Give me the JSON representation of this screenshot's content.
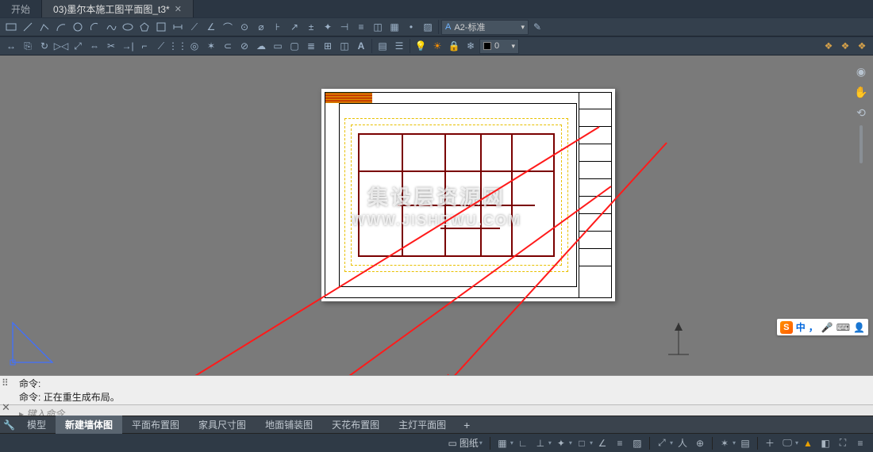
{
  "tabs": {
    "start": "开始",
    "file": "03)墨尔本施工图平面图_t3*"
  },
  "layer": {
    "combo": "A2-标准"
  },
  "color": {
    "label": "0"
  },
  "watermark": {
    "line1": "集设层资源网",
    "line2": "WWW.JISHEWU.COM"
  },
  "command": {
    "prompt1": "命令:",
    "prompt2": "命令:",
    "status": "正在重生成布局。",
    "input_placeholder": "键入命令"
  },
  "layout_tabs": [
    "模型",
    "新建墙体图",
    "平面布置图",
    "家具尺寸图",
    "地面铺装图",
    "天花布置图",
    "主灯平面图"
  ],
  "statusbar": {
    "paper": "图纸",
    "ime_zh": "中",
    "ime_punct": "，"
  },
  "icons": {
    "layer_a": "A"
  }
}
